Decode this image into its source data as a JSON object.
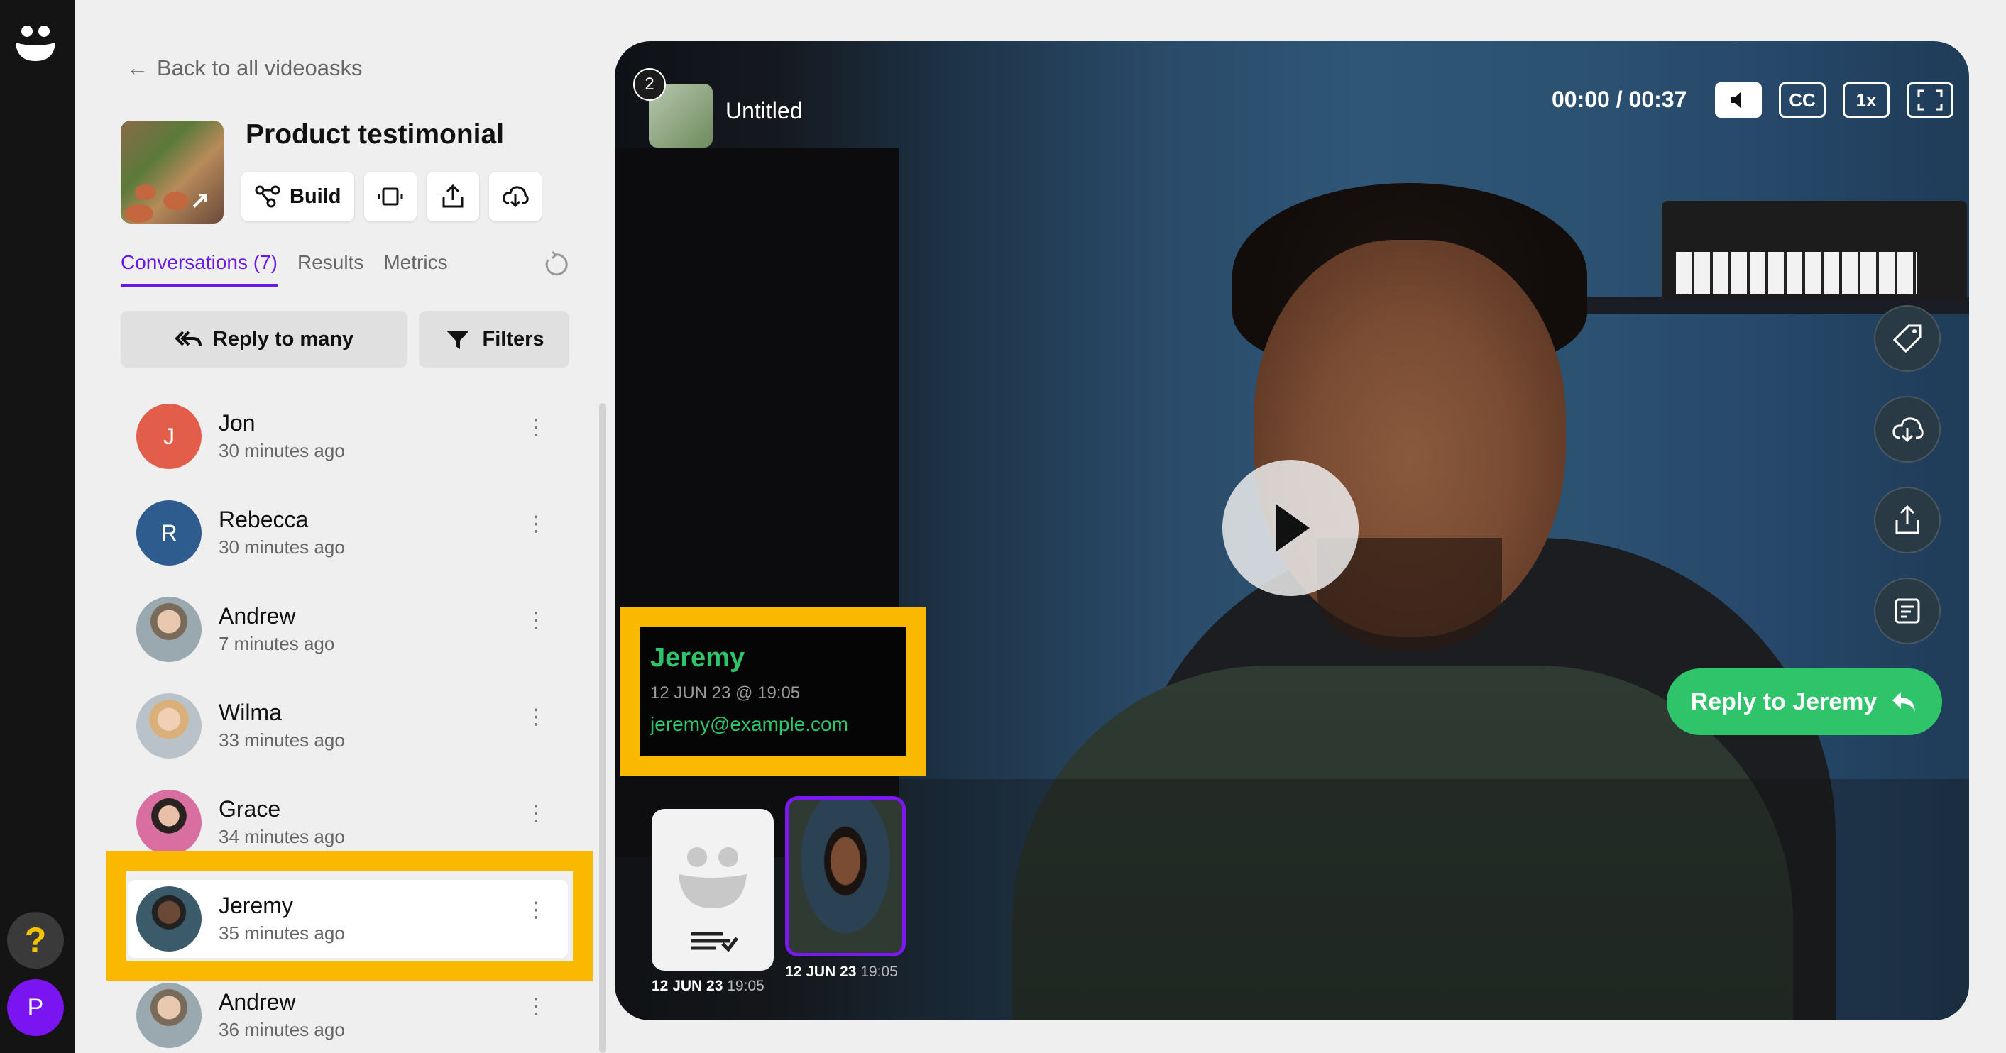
{
  "nav": {
    "back_label": "Back to all videoasks",
    "help_glyph": "?",
    "profile_initial": "P"
  },
  "videoask": {
    "title": "Product testimonial",
    "build_label": "Build"
  },
  "tabs": {
    "conversations": "Conversations (7)",
    "results": "Results",
    "metrics": "Metrics"
  },
  "actions": {
    "reply_many": "Reply to many",
    "filters": "Filters"
  },
  "conversations": [
    {
      "name": "Jon",
      "time": "30 minutes ago",
      "initial": "J",
      "color": "#e35d4b"
    },
    {
      "name": "Rebecca",
      "time": "30 minutes ago",
      "initial": "R",
      "color": "#2f5c8f"
    },
    {
      "name": "Andrew",
      "time": "7 minutes ago",
      "initial": ""
    },
    {
      "name": "Wilma",
      "time": "33 minutes ago",
      "initial": ""
    },
    {
      "name": "Grace",
      "time": "34 minutes ago",
      "initial": ""
    },
    {
      "name": "Jeremy",
      "time": "35 minutes ago",
      "initial": ""
    },
    {
      "name": "Andrew",
      "time": "36 minutes ago",
      "initial": ""
    }
  ],
  "player": {
    "step_count": "2",
    "title": "Untitled",
    "time": "00:00 / 00:37",
    "cc_label": "CC",
    "speed_label": "1x",
    "reply_label": "Reply to Jeremy"
  },
  "respondent": {
    "name": "Jeremy",
    "date": "12 JUN 23 @ 19:05",
    "email": "jeremy@example.com"
  },
  "clips": [
    {
      "date": "12 JUN 23",
      "time": "19:05"
    },
    {
      "date": "12 JUN 23",
      "time": "19:05"
    }
  ],
  "colors": {
    "accent_purple": "#6a18e6",
    "reply_green": "#2fc36a",
    "highlight_yellow": "#fbb800"
  }
}
